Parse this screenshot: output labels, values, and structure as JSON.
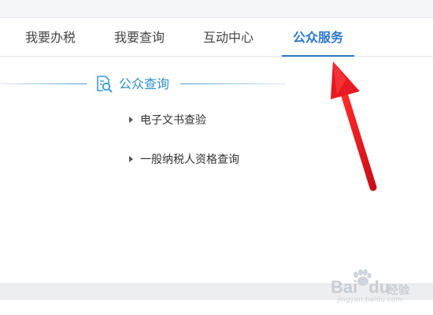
{
  "nav": {
    "items": [
      {
        "label": "我要办税",
        "active": false
      },
      {
        "label": "我要查询",
        "active": false
      },
      {
        "label": "互动中心",
        "active": false
      },
      {
        "label": "公众服务",
        "active": true
      }
    ]
  },
  "section": {
    "title": "公众查询",
    "icon": "document-search-icon"
  },
  "list": {
    "items": [
      {
        "label": "电子文书查验"
      },
      {
        "label": "一般纳税人资格查询"
      }
    ]
  },
  "annotation": {
    "arrow_color": "#e8191f"
  },
  "watermark": {
    "brand": "Bai",
    "brand_tail": "du",
    "sub": "经验",
    "url": "jingyan.baidu.com"
  },
  "colors": {
    "accent": "#2c78c8",
    "section_blue": "#2f8fc9"
  }
}
